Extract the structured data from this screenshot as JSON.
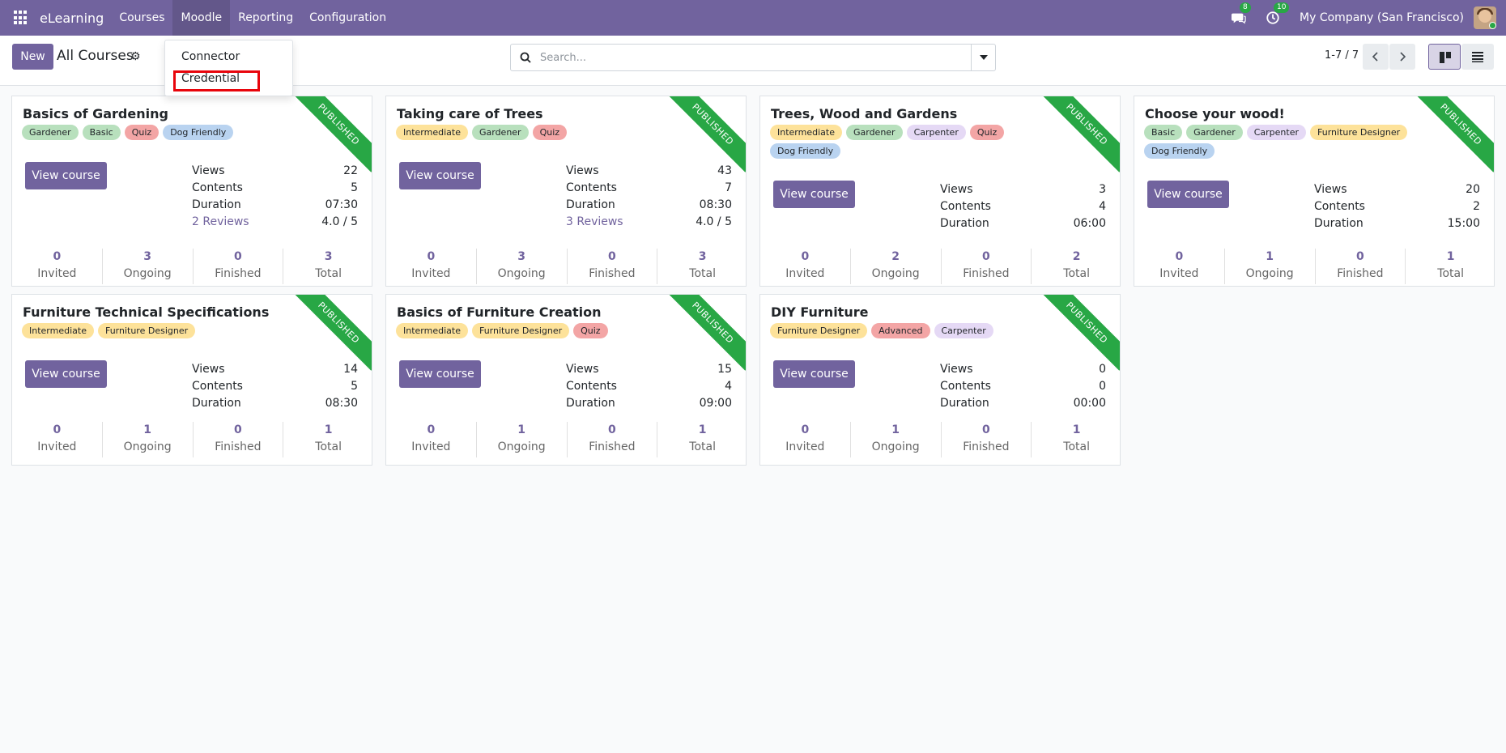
{
  "navbar": {
    "brand": "eLearning",
    "menu": [
      "Courses",
      "Moodle",
      "Reporting",
      "Configuration"
    ],
    "active_menu": "Moodle",
    "chat_badge": "8",
    "activity_badge": "10",
    "company": "My Company (San Francisco)"
  },
  "control": {
    "new_label": "New",
    "breadcrumb": "All Courses",
    "search_placeholder": "Search...",
    "pager": "1-7 / 7"
  },
  "dropdown": {
    "items": [
      "Connector",
      "Credential"
    ]
  },
  "colors": {
    "primary": "#71639e",
    "published": "#28a745",
    "highlight": "#e8050c"
  },
  "ribbon_label": "PUBLISHED",
  "view_course_label": "View course",
  "stat_labels": {
    "views": "Views",
    "contents": "Contents",
    "duration": "Duration"
  },
  "count_labels": {
    "invited": "Invited",
    "ongoing": "Ongoing",
    "finished": "Finished",
    "total": "Total"
  },
  "courses": [
    {
      "title": "Basics of Gardening",
      "tags": [
        "Gardener",
        "Basic",
        "Quiz",
        "Dog Friendly"
      ],
      "views": "22",
      "contents": "5",
      "duration": "07:30",
      "reviews": "2 Reviews",
      "rating": "4.0 / 5",
      "invited": "0",
      "ongoing": "3",
      "finished": "0",
      "total": "3"
    },
    {
      "title": "Taking care of Trees",
      "tags": [
        "Intermediate",
        "Gardener",
        "Quiz"
      ],
      "views": "43",
      "contents": "7",
      "duration": "08:30",
      "reviews": "3 Reviews",
      "rating": "4.0 / 5",
      "invited": "0",
      "ongoing": "3",
      "finished": "0",
      "total": "3"
    },
    {
      "title": "Trees, Wood and Gardens",
      "tags": [
        "Intermediate",
        "Gardener",
        "Carpenter",
        "Quiz",
        "Dog Friendly"
      ],
      "views": "3",
      "contents": "4",
      "duration": "06:00",
      "invited": "0",
      "ongoing": "2",
      "finished": "0",
      "total": "2"
    },
    {
      "title": "Choose your wood!",
      "tags": [
        "Basic",
        "Gardener",
        "Carpenter",
        "Furniture Designer",
        "Dog Friendly"
      ],
      "views": "20",
      "contents": "2",
      "duration": "15:00",
      "invited": "0",
      "ongoing": "1",
      "finished": "0",
      "total": "1"
    },
    {
      "title": "Furniture Technical Specifications",
      "tags": [
        "Intermediate",
        "Furniture Designer"
      ],
      "views": "14",
      "contents": "5",
      "duration": "08:30",
      "invited": "0",
      "ongoing": "1",
      "finished": "0",
      "total": "1"
    },
    {
      "title": "Basics of Furniture Creation",
      "tags": [
        "Intermediate",
        "Furniture Designer",
        "Quiz"
      ],
      "views": "15",
      "contents": "4",
      "duration": "09:00",
      "invited": "0",
      "ongoing": "1",
      "finished": "0",
      "total": "1"
    },
    {
      "title": "DIY Furniture",
      "tags": [
        "Furniture Designer",
        "Advanced",
        "Carpenter"
      ],
      "views": "0",
      "contents": "0",
      "duration": "00:00",
      "invited": "0",
      "ongoing": "1",
      "finished": "0",
      "total": "1"
    }
  ]
}
